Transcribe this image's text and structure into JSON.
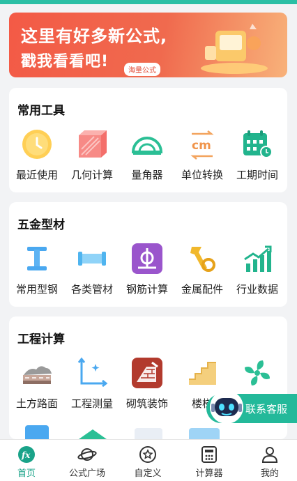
{
  "banner": {
    "line1": "这里有好多新公式,",
    "line2": "戳我看看吧!",
    "tag": "海量公式"
  },
  "sections": [
    {
      "title": "常用工具",
      "tools": [
        {
          "label": "最近使用",
          "icon": "clock-icon"
        },
        {
          "label": "几何计算",
          "icon": "cube-icon"
        },
        {
          "label": "量角器",
          "icon": "protractor-icon"
        },
        {
          "label": "单位转换",
          "icon": "unit-convert-icon"
        },
        {
          "label": "工期时间",
          "icon": "calendar-icon"
        }
      ]
    },
    {
      "title": "五金型材",
      "tools": [
        {
          "label": "常用型钢",
          "icon": "i-beam-icon"
        },
        {
          "label": "各类管材",
          "icon": "pipe-icon"
        },
        {
          "label": "钢筋计算",
          "icon": "rebar-icon"
        },
        {
          "label": "金属配件",
          "icon": "hardware-icon"
        },
        {
          "label": "行业数据",
          "icon": "bar-chart-icon"
        }
      ]
    },
    {
      "title": "工程计算",
      "tools": [
        {
          "label": "土方路面",
          "icon": "road-icon"
        },
        {
          "label": "工程测量",
          "icon": "measure-icon"
        },
        {
          "label": "砌筑装饰",
          "icon": "brick-icon"
        },
        {
          "label": "楼梯",
          "icon": "stairs-icon"
        },
        {
          "label": "",
          "icon": "fan-icon"
        }
      ]
    }
  ],
  "service": {
    "label": "联系客服"
  },
  "nav": [
    {
      "label": "首页",
      "icon": "fx-icon",
      "active": true
    },
    {
      "label": "公式广场",
      "icon": "planet-icon",
      "active": false
    },
    {
      "label": "自定义",
      "icon": "star-badge-icon",
      "active": false
    },
    {
      "label": "计算器",
      "icon": "calculator-icon",
      "active": false
    },
    {
      "label": "我的",
      "icon": "user-icon",
      "active": false
    }
  ],
  "colors": {
    "accent": "#1aa389",
    "service": "#23b99a",
    "banner": "#f35a46"
  }
}
